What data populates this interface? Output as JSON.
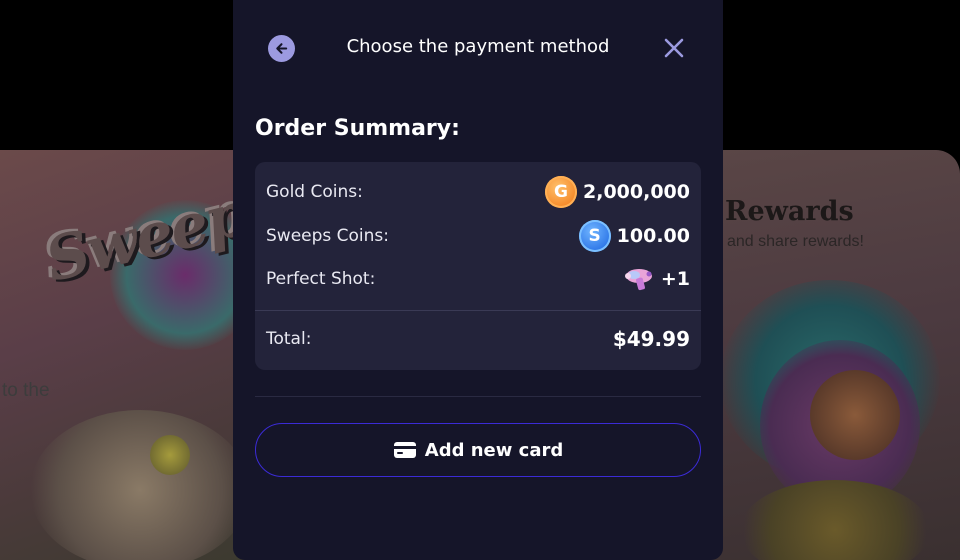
{
  "background": {
    "logo_text": "Sweepi",
    "left_text": "to the",
    "rewards_title": "Rewards",
    "rewards_subtitle": "and share rewards!"
  },
  "modal": {
    "title": "Choose the payment method",
    "back_icon": "arrow-left-icon",
    "close_icon": "close-icon"
  },
  "order_summary": {
    "heading": "Order Summary:",
    "rows": [
      {
        "label": "Gold Coins:",
        "value": "2,000,000",
        "icon": "gold-coin-icon",
        "icon_glyph": "G",
        "color": "#f58a2a"
      },
      {
        "label": "Sweeps Coins:",
        "value": "100.00",
        "icon": "sweeps-coin-icon",
        "icon_glyph": "S",
        "color": "#2f78e8"
      },
      {
        "label": "Perfect Shot:",
        "value": "+1",
        "icon": "perfect-shot-gun-icon"
      }
    ],
    "total_label": "Total:",
    "total_value": "$49.99"
  },
  "actions": {
    "add_card_label": "Add new card",
    "add_card_icon": "credit-card-icon"
  },
  "colors": {
    "modal_bg": "#151529",
    "summary_bg": "#23233a",
    "accent_border": "#3b2bd6",
    "back_button": "#9c9ae0"
  }
}
